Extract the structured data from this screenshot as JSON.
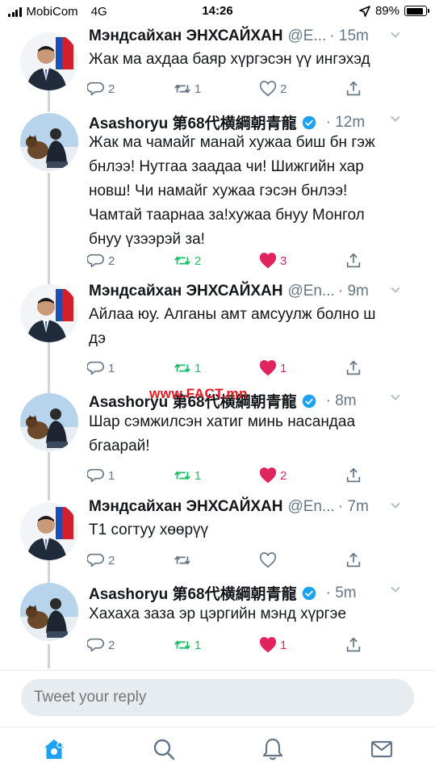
{
  "status": {
    "carrier": "MobiCom",
    "network": "4G",
    "time": "14:26",
    "battery": "89%",
    "battery_level": 0.89
  },
  "watermark": "www.FACT.mn",
  "tweets": [
    {
      "name": "Мэндсайхан ЭНХСАЙХАН",
      "handle": "@E...",
      "time": "· 15m",
      "verified": false,
      "lines": [
        "Жак ма ахдаа баяр хүргэсэн үү ингэхэд"
      ],
      "replies": "2",
      "retweets": "1",
      "likes": "2",
      "retweeted": false,
      "liked": false
    },
    {
      "name": "Asashoryu 第68代横綱朝青龍",
      "handle": "",
      "time": "· 12m",
      "verified": true,
      "lines": [
        "Жак ма чамайг манай хужаа биш бн гэж",
        "бнлээ! Нутгаа заадаа чи! Шижгийн хар",
        "новш! Чи намайг хужаа гэсэн бнлээ!",
        "Чамтай таарнаа за!хужаа бнуу Монгол",
        "бнуу үзээрэй за!"
      ],
      "replies": "2",
      "retweets": "2",
      "likes": "3",
      "retweeted": true,
      "liked": true
    },
    {
      "name": "Мэндсайхан ЭНХСАЙХАН",
      "handle": "@En...",
      "time": "· 9m",
      "verified": false,
      "lines": [
        "Айлаа юу. Алганы амт амсуулж болно ш",
        "дэ"
      ],
      "replies": "1",
      "retweets": "1",
      "likes": "1",
      "retweeted": true,
      "liked": true
    },
    {
      "name": "Asashoryu 第68代横綱朝青龍",
      "handle": "",
      "time": "· 8m",
      "verified": true,
      "lines": [
        "Шар сэмжилсэн хатиг минь насандаа",
        "бгаарай!"
      ],
      "replies": "1",
      "retweets": "1",
      "likes": "2",
      "retweeted": true,
      "liked": true
    },
    {
      "name": "Мэндсайхан ЭНХСАЙХАН",
      "handle": "@En...",
      "time": "· 7m",
      "verified": false,
      "lines": [
        "Т1 согтуу хөөрүү"
      ],
      "replies": "2",
      "retweets": "",
      "likes": "",
      "retweeted": false,
      "liked": false
    },
    {
      "name": "Asashoryu 第68代横綱朝青龍",
      "handle": "",
      "time": "· 5m",
      "verified": true,
      "lines": [
        "Хахаха заза эр цэргийн мэнд хүргэе"
      ],
      "replies": "2",
      "retweets": "1",
      "likes": "1",
      "retweeted": true,
      "liked": true
    }
  ],
  "reply": {
    "placeholder": "Tweet your reply"
  },
  "colors": {
    "accent": "#1da1f2",
    "retweet": "#17bf63",
    "like": "#e0245e",
    "muted": "#657786"
  }
}
